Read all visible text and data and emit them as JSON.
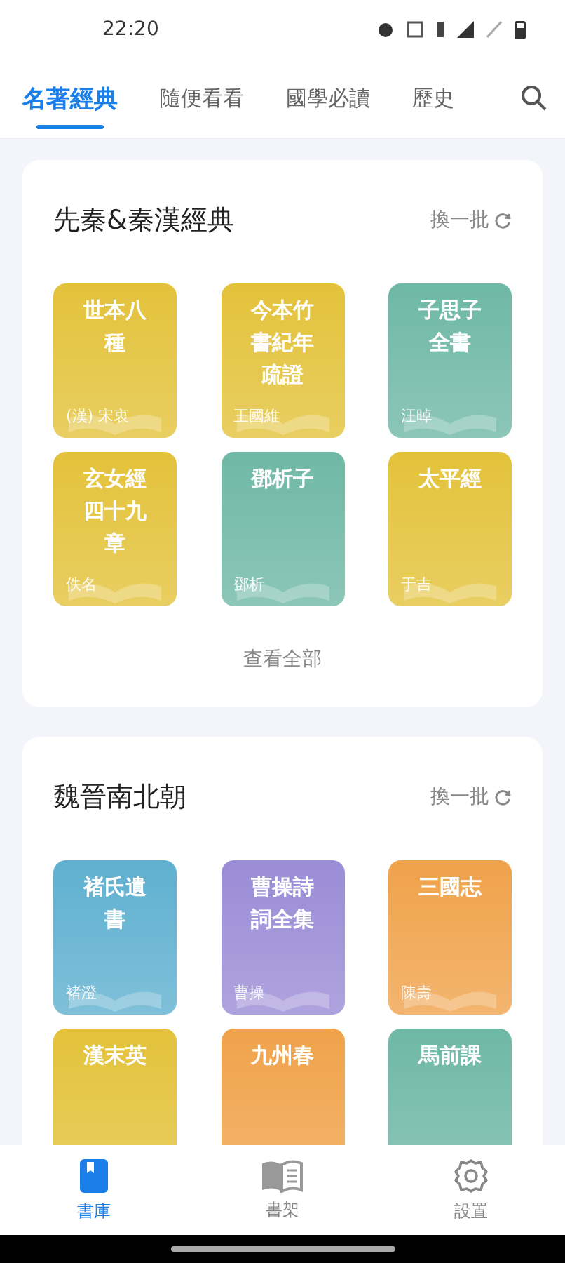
{
  "status_bar": {
    "time": "22:20"
  },
  "tabs": [
    {
      "label": "名著經典",
      "selected": true
    },
    {
      "label": "隨便看看",
      "selected": false
    },
    {
      "label": "國學必讀",
      "selected": false
    },
    {
      "label": "歷史",
      "selected": false
    }
  ],
  "sections": [
    {
      "title": "先秦&秦漢經典",
      "refresh": "換一批",
      "more": "查看全部",
      "books": [
        {
          "title": "世本八種",
          "author": "(漢) 宋衷",
          "color": "#e3c23a"
        },
        {
          "title": "今本竹書紀年疏證",
          "author": "王國維",
          "color": "#e3c23a"
        },
        {
          "title": "子思子全書",
          "author": "汪晫",
          "color": "#6fb8a6"
        },
        {
          "title": "玄女經四十九章",
          "author": "佚名",
          "color": "#e3c23a"
        },
        {
          "title": "鄧析子",
          "author": "鄧析",
          "color": "#6fb8a6"
        },
        {
          "title": "太平經",
          "author": "于吉",
          "color": "#e3c23a"
        }
      ]
    },
    {
      "title": "魏晉南北朝",
      "refresh": "換一批",
      "books": [
        {
          "title": "褚氏遺書",
          "author": "褚澄",
          "color": "#5fb0d0"
        },
        {
          "title": "曹操詩詞全集",
          "author": "曹操",
          "color": "#9a8cd6"
        },
        {
          "title": "三國志",
          "author": "陳壽",
          "color": "#f0a24a"
        },
        {
          "title": "漢末英",
          "color": "#e3c23a"
        },
        {
          "title": "九州春",
          "color": "#f0a24a"
        },
        {
          "title": "馬前課",
          "color": "#6fb8a6"
        }
      ]
    }
  ],
  "bottom_nav": [
    {
      "label": "書庫",
      "selected": true,
      "kind": "library"
    },
    {
      "label": "書架",
      "selected": false,
      "kind": "shelf"
    },
    {
      "label": "設置",
      "selected": false,
      "kind": "settings"
    }
  ]
}
